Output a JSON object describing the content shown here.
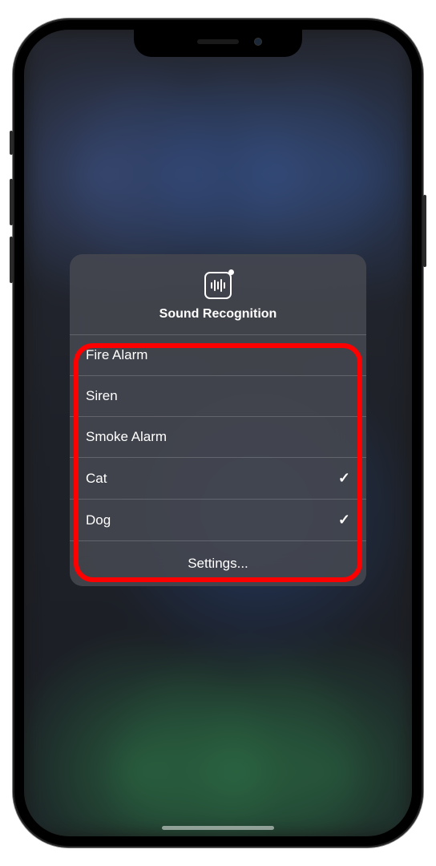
{
  "popup": {
    "title": "Sound Recognition",
    "icon_name": "sound-recognition-icon",
    "options": [
      {
        "label": "Fire Alarm",
        "checked": false
      },
      {
        "label": "Siren",
        "checked": false
      },
      {
        "label": "Smoke Alarm",
        "checked": false
      },
      {
        "label": "Cat",
        "checked": true
      },
      {
        "label": "Dog",
        "checked": true
      }
    ],
    "settings_label": "Settings...",
    "checkmark_glyph": "✓"
  },
  "annotation": {
    "highlight_color": "#ff0000"
  }
}
